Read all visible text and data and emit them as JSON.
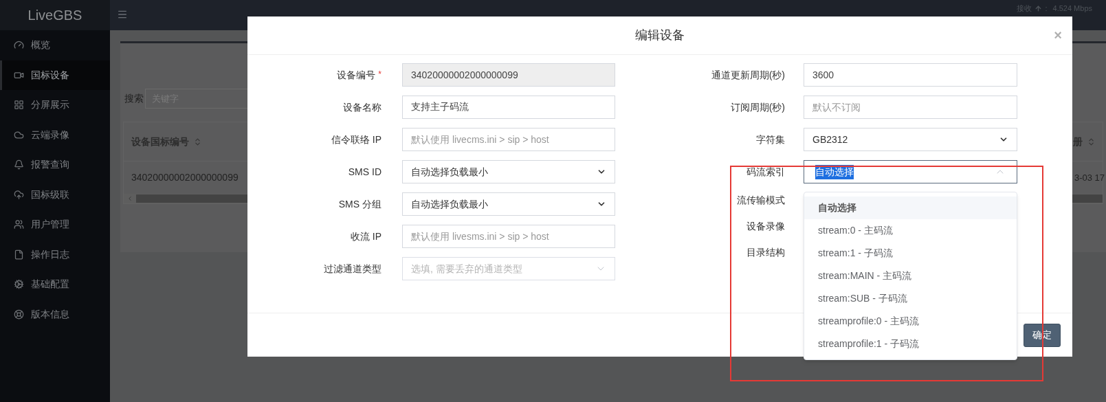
{
  "brand": "LiveGBS",
  "sidebar": {
    "items": [
      {
        "label": "概览",
        "selected": false
      },
      {
        "label": "国标设备",
        "selected": true
      },
      {
        "label": "分屏展示",
        "selected": false
      },
      {
        "label": "云端录像",
        "selected": false
      },
      {
        "label": "报警查询",
        "selected": false
      },
      {
        "label": "国标级联",
        "selected": false
      },
      {
        "label": "用户管理",
        "selected": false
      },
      {
        "label": "操作日志",
        "selected": false
      },
      {
        "label": "基础配置",
        "selected": false
      },
      {
        "label": "版本信息",
        "selected": false
      }
    ]
  },
  "header": {
    "network": {
      "label": "接收",
      "separator": ":",
      "rate": "4.524 Mbps"
    }
  },
  "background": {
    "search_label": "搜索",
    "search_placeholder": "关键字",
    "table": {
      "columns": [
        "设备国标编号",
        "册"
      ],
      "rows": [
        [
          "34020000002000000099",
          "3-03 17"
        ]
      ]
    }
  },
  "modal": {
    "title": "编辑设备",
    "close": "×",
    "left_fields": [
      {
        "label": "设备编号",
        "mark": "*",
        "kind": "input",
        "value": "34020000002000000099",
        "readonly": true
      },
      {
        "label": "设备名称",
        "kind": "input",
        "value": "支持主子码流",
        "readonly": false
      },
      {
        "label": "信令联络 IP",
        "kind": "input",
        "placeholder": "默认使用 livecms.ini > sip > host",
        "readonly": false
      },
      {
        "label": "SMS ID",
        "kind": "select",
        "value": "自动选择负载最小"
      },
      {
        "label": "SMS 分组",
        "kind": "select",
        "value": "自动选择负载最小"
      },
      {
        "label": "收流 IP",
        "kind": "input",
        "placeholder": "默认使用 livesms.ini > sip > host",
        "readonly": false
      },
      {
        "label": "过滤通道类型",
        "kind": "tags",
        "placeholder": "选填, 需要丢弃的通道类型"
      }
    ],
    "right_fields": [
      {
        "label": "通道更新周期(秒)",
        "kind": "input",
        "value": "3600",
        "readonly": false
      },
      {
        "label": "订阅周期(秒)",
        "kind": "input",
        "placeholder": "默认不订阅",
        "readonly": false
      },
      {
        "label": "字符集",
        "kind": "select",
        "value": "GB2312"
      },
      {
        "label": "码流索引",
        "kind": "combobox",
        "value": "自动选择",
        "highlighted": true,
        "options": [
          {
            "label": "自动选择",
            "selected": true
          },
          {
            "label": "stream:0 - 主码流",
            "selected": false
          },
          {
            "label": "stream:1 - 子码流",
            "selected": false
          },
          {
            "label": "stream:MAIN - 主码流",
            "selected": false
          },
          {
            "label": "stream:SUB - 子码流",
            "selected": false
          },
          {
            "label": "streamprofile:0 - 主码流",
            "selected": false
          },
          {
            "label": "streamprofile:1 - 子码流",
            "selected": false
          }
        ]
      },
      {
        "label": "流传输模式",
        "kind": "hidden"
      },
      {
        "label": "设备录像",
        "kind": "hidden"
      },
      {
        "label": "目录结构",
        "kind": "hidden"
      }
    ],
    "buttons": [
      {
        "label": "确定"
      }
    ]
  }
}
